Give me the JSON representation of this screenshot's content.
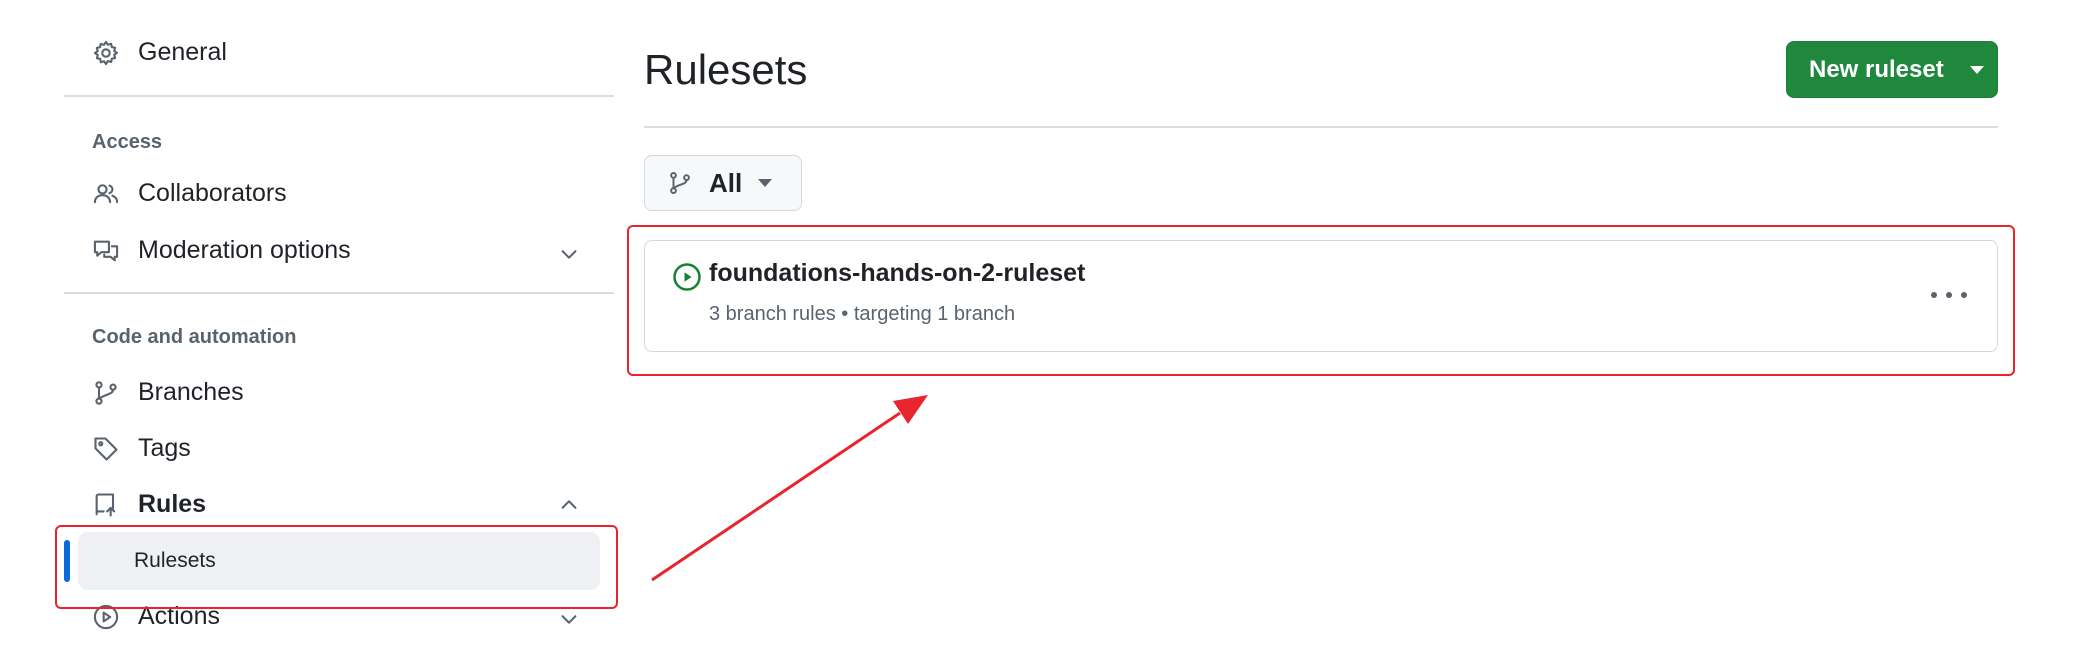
{
  "sidebar": {
    "general": "General",
    "access_label": "Access",
    "collaborators": "Collaborators",
    "moderation": "Moderation options",
    "code_label": "Code and automation",
    "branches": "Branches",
    "tags": "Tags",
    "rules": "Rules",
    "rulesets": "Rulesets",
    "actions": "Actions"
  },
  "main": {
    "title": "Rulesets",
    "new_button": "New ruleset",
    "filter": "All",
    "ruleset": {
      "name": "foundations-hands-on-2-ruleset",
      "meta": "3 branch rules • targeting 1 branch",
      "status": "active"
    }
  },
  "colors": {
    "accent": "#0969da",
    "primary_button": "#1f883d",
    "annotation": "#e8242d"
  },
  "icons": [
    "gear-icon",
    "people-icon",
    "comment-discussion-icon",
    "git-branch-icon",
    "tag-icon",
    "repo-push-icon",
    "play-icon",
    "chevron-down-icon",
    "chevron-up-icon",
    "kebab-horizontal-icon",
    "triangle-down-icon"
  ]
}
